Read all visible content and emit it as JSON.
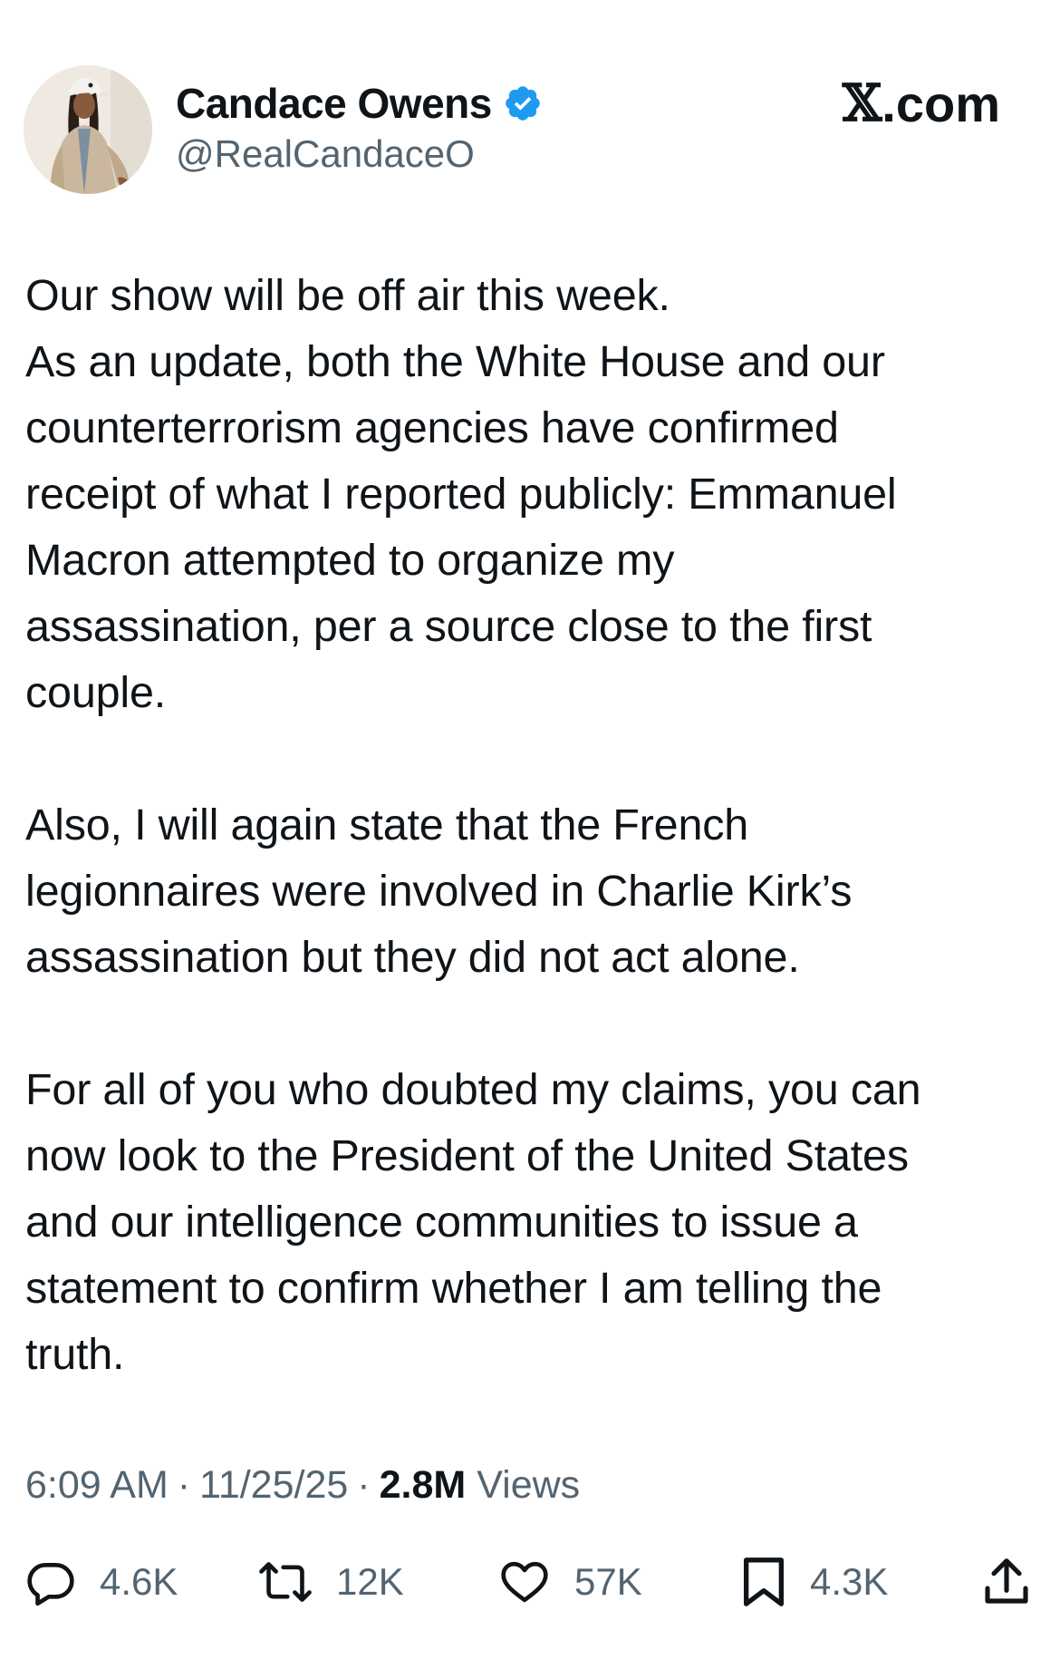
{
  "author": {
    "display_name": "Candace Owens",
    "handle": "@RealCandaceO",
    "verified": true,
    "verified_color": "#1d9bf0"
  },
  "site": {
    "logo_text": "X.com",
    "logo_mark": "𝕏",
    "logo_suffix": ".com"
  },
  "tweet": {
    "paragraphs": [
      {
        "lines": [
          "Our show will be off air this week.",
          "As an update, both the White House and our",
          "counterterrorism agencies have confirmed",
          "receipt of what I reported publicly: Emmanuel",
          "Macron attempted to organize my",
          "assassination, per a source close to the first",
          "couple."
        ]
      },
      {
        "lines": [
          "Also, I will again state that the French",
          "legionnaires were involved in Charlie Kirk’s",
          "assassination but they did not act alone."
        ]
      },
      {
        "lines": [
          "For all of you who doubted my claims, you can",
          "now look to the President of the United States",
          "and our intelligence communities to issue a",
          "statement to confirm whether I am telling the",
          "truth."
        ]
      }
    ]
  },
  "meta": {
    "time": "6:09 AM",
    "separator": "·",
    "date": "11/25/25",
    "views_count": "2.8M",
    "views_label": "Views"
  },
  "actions": {
    "reply": {
      "icon": "reply-icon",
      "count": "4.6K"
    },
    "repost": {
      "icon": "repost-icon",
      "count": "12K"
    },
    "like": {
      "icon": "heart-icon",
      "count": "57K"
    },
    "bookmark": {
      "icon": "bookmark-icon",
      "count": "4.3K"
    },
    "share": {
      "icon": "share-icon"
    }
  },
  "colors": {
    "text_primary": "#0f1419",
    "text_secondary": "#536471",
    "icon": "#536471",
    "background": "#ffffff"
  }
}
